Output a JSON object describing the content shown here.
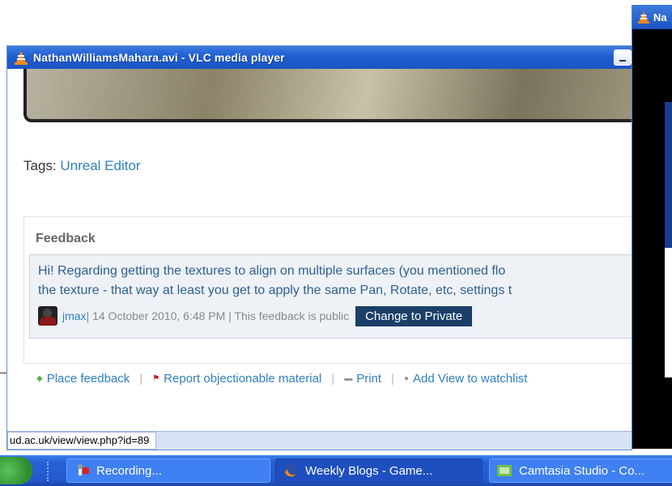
{
  "window": {
    "title": "NathanWilliamsMahara.avi - VLC media player",
    "status_text": "ud.ac.uk/view/view.php?id=89"
  },
  "page": {
    "tags_label": "Tags:",
    "tags_value": "Unreal Editor",
    "feedback_heading": "Feedback",
    "feedback_line1": "Hi! Regarding getting the textures to align on multiple surfaces (you mentioned flo",
    "feedback_line2": "the texture - that way at least you get to apply the same Pan, Rotate, etc, settings t",
    "author": "jmax",
    "meta": " | 14 October 2010, 6:48 PM | This feedback is public",
    "change_private_label": "Change to Private",
    "actions": {
      "place": "Place feedback",
      "report": "Report objectionable material",
      "print": "Print",
      "watch": "Add View to watchlist"
    }
  },
  "second_window": {
    "title": "Na"
  },
  "taskbar": {
    "items": [
      {
        "label": "Recording...",
        "icon": "recording-icon"
      },
      {
        "label": "Weekly Blogs - Game...",
        "icon": "firefox-icon"
      },
      {
        "label": "Camtasia Studio - Co...",
        "icon": "camtasia-icon"
      }
    ]
  },
  "colors": {
    "titlebar": "#1f5fd2",
    "link": "#2f7fc1",
    "button_dark": "#1b3f69",
    "taskbar": "#2558cf"
  }
}
